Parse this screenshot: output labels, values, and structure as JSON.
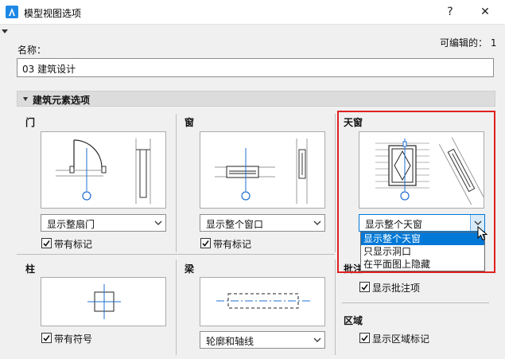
{
  "window": {
    "title": "模型视图选项",
    "help_label": "?",
    "close_label": "✕"
  },
  "name_field": {
    "label": "名称：",
    "value": "03 建筑设计",
    "editable_count": "可编辑的： 1"
  },
  "section": {
    "title": "建筑元素选项"
  },
  "door": {
    "title": "门",
    "dropdown_value": "显示整扇门",
    "checkbox_label": "带有标记",
    "checked": true
  },
  "window_group": {
    "title": "窗",
    "dropdown_value": "显示整个窗口",
    "checkbox_label": "带有标记",
    "checked": true
  },
  "skylight": {
    "title": "天窗",
    "dropdown_value": "显示整个天窗",
    "options": [
      "显示整个天窗",
      "只显示洞口",
      "在平面图上隐藏"
    ],
    "selected_option": "显示整个天窗"
  },
  "column": {
    "title": "柱",
    "checkbox_label": "带有符号",
    "checked": true
  },
  "beam": {
    "title": "梁",
    "dropdown_value": "轮廓和轴线"
  },
  "annotation": {
    "title_partial": "批注",
    "checkbox_label": "显示批注项",
    "checked": true
  },
  "zone": {
    "title": "区域",
    "checkbox_label": "显示区域标记",
    "checked": true
  },
  "colors": {
    "accent": "#0078d7",
    "highlight_border": "#e02020",
    "symbol_blue": "#1f6fd1"
  }
}
